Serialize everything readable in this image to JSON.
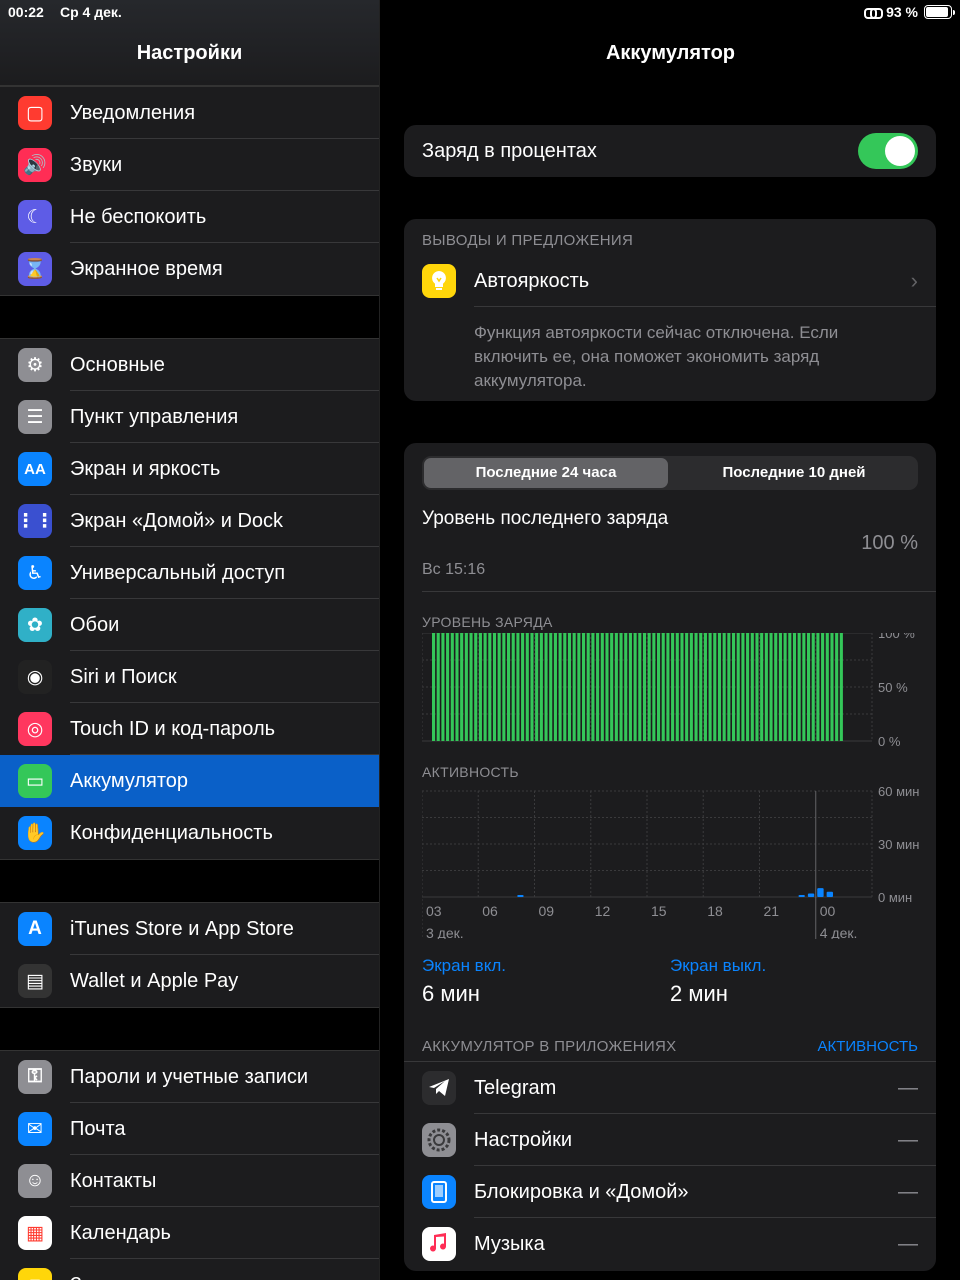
{
  "status": {
    "time": "00:22",
    "date": "Ср 4 дек.",
    "battery": "93 %",
    "battery_level": 0.93
  },
  "sidebar": {
    "title": "Настройки",
    "groups": [
      [
        {
          "label": "Уведомления",
          "icon": "notifications-icon",
          "color": "#ff3b30"
        },
        {
          "label": "Звуки",
          "icon": "speaker-icon",
          "color": "#ff2d55"
        },
        {
          "label": "Не беспокоить",
          "icon": "moon-icon",
          "color": "#5e5ce6"
        },
        {
          "label": "Экранное время",
          "icon": "hourglass-icon",
          "color": "#5e5ce6"
        }
      ],
      [
        {
          "label": "Основные",
          "icon": "gear-icon",
          "color": "#8e8e93"
        },
        {
          "label": "Пункт управления",
          "icon": "switches-icon",
          "color": "#8e8e93"
        },
        {
          "label": "Экран и яркость",
          "icon": "text-size-icon",
          "color": "#0a84ff"
        },
        {
          "label": "Экран «Домой» и Dock",
          "icon": "home-grid-icon",
          "color": "#3a50d0"
        },
        {
          "label": "Универсальный доступ",
          "icon": "accessibility-icon",
          "color": "#0a84ff"
        },
        {
          "label": "Обои",
          "icon": "flower-icon",
          "color": "#30b0c7"
        },
        {
          "label": "Siri и Поиск",
          "icon": "siri-icon",
          "color": "#222"
        },
        {
          "label": "Touch ID и код-пароль",
          "icon": "fingerprint-icon",
          "color": "#ff375f"
        },
        {
          "label": "Аккумулятор",
          "icon": "battery-icon",
          "color": "#34c759",
          "active": true
        },
        {
          "label": "Конфиденциальность",
          "icon": "hand-icon",
          "color": "#0a84ff"
        }
      ],
      [
        {
          "label": "iTunes Store и App Store",
          "icon": "app-store-icon",
          "color": "#0a84ff"
        },
        {
          "label": "Wallet и Apple Pay",
          "icon": "wallet-icon",
          "color": "#333"
        }
      ],
      [
        {
          "label": "Пароли и учетные записи",
          "icon": "key-icon",
          "color": "#8e8e93"
        },
        {
          "label": "Почта",
          "icon": "mail-icon",
          "color": "#0a84ff"
        },
        {
          "label": "Контакты",
          "icon": "contacts-icon",
          "color": "#8e8e93"
        },
        {
          "label": "Календарь",
          "icon": "calendar-icon",
          "color": "#fff"
        },
        {
          "label": "Заметки",
          "icon": "notes-icon",
          "color": "#ffd60a"
        }
      ]
    ]
  },
  "detail": {
    "title": "Аккумулятор",
    "percent_label": "Заряд в процентах",
    "percent_on": true,
    "insights": {
      "caption": "ВЫВОДЫ И ПРЕДЛОЖЕНИЯ",
      "item": "Автояркость",
      "description": "Функция автояркости сейчас отключена. Если включить ее, она поможет экономить заряд аккумулятора."
    },
    "segments": [
      "Последние 24 часа",
      "Последние 10 дней"
    ],
    "last_charge": {
      "title": "Уровень последнего заряда",
      "time": "Вс 15:16",
      "value": "100 %"
    },
    "level_caption": "УРОВЕНЬ ЗАРЯДА",
    "level_ticks": [
      "100 %",
      "50 %",
      "0 %"
    ],
    "activity_caption": "АКТИВНОСТЬ",
    "activity_ticks": [
      "60 мин",
      "30 мин",
      "0 мин"
    ],
    "x_ticks": [
      "03",
      "06",
      "09",
      "12",
      "15",
      "18",
      "21",
      "00"
    ],
    "x_dates": [
      "3 дек.",
      "4 дек."
    ],
    "screen_on": {
      "label": "Экран вкл.",
      "value": "6 мин"
    },
    "screen_off": {
      "label": "Экран выкл.",
      "value": "2 мин"
    },
    "apps_caption": "АККУМУЛЯТОР В ПРИЛОЖЕНИЯХ",
    "apps_action": "АКТИВНОСТЬ",
    "apps": [
      {
        "name": "Telegram",
        "value": "—",
        "icon": "telegram-icon"
      },
      {
        "name": "Настройки",
        "value": "—",
        "icon": "settings-gear-icon"
      },
      {
        "name": "Блокировка и «Домой»",
        "value": "—",
        "icon": "ipad-icon"
      },
      {
        "name": "Музыка",
        "value": "—",
        "icon": "music-icon"
      }
    ]
  },
  "chart_data": [
    {
      "type": "bar",
      "ylabel": "УРОВЕНЬ ЗАРЯДА",
      "ylim": [
        0,
        100
      ],
      "x": [
        "03",
        "06",
        "09",
        "12",
        "15",
        "18",
        "21",
        "00"
      ],
      "values_note_none": true,
      "values": [
        100,
        100,
        100,
        100,
        100,
        100,
        100,
        100,
        100,
        100,
        100,
        100,
        100,
        100,
        100,
        100,
        100,
        100,
        100,
        100,
        100,
        100,
        100,
        100,
        100,
        100,
        100,
        100,
        100,
        100,
        100,
        100,
        100,
        100,
        100,
        100,
        100,
        100,
        100,
        100,
        100,
        100,
        100,
        100,
        100,
        100,
        100,
        100,
        100,
        100,
        100,
        100,
        100,
        100,
        100,
        100,
        100,
        100,
        100,
        100,
        100,
        100,
        100,
        100,
        100,
        100,
        100,
        100,
        100,
        100,
        100,
        100,
        100,
        100,
        100,
        100,
        100,
        100,
        100,
        100,
        100,
        100,
        100,
        100,
        100,
        100,
        100,
        100,
        0,
        0,
        0,
        0,
        0,
        0,
        0,
        0
      ],
      "color": "#34c759"
    },
    {
      "type": "bar",
      "ylabel": "АКТИВНОСТЬ",
      "ylim": [
        0,
        60
      ],
      "x": [
        "03",
        "06",
        "09",
        "12",
        "15",
        "18",
        "21",
        "00"
      ],
      "values": [
        0,
        0,
        0,
        0,
        0,
        0,
        0,
        0,
        0,
        0,
        0,
        0,
        0,
        0,
        0,
        0,
        0,
        0,
        0,
        0,
        0,
        0,
        0,
        0,
        0,
        0,
        0,
        0,
        0,
        0,
        0,
        0,
        0,
        0,
        0,
        0,
        0,
        0,
        0,
        0,
        0,
        0,
        0,
        0,
        0,
        0,
        0,
        0,
        0,
        0,
        0,
        0,
        0,
        0,
        0,
        0,
        0,
        0,
        0,
        0,
        0,
        0,
        0,
        0,
        0,
        0,
        0,
        0,
        0,
        0,
        0,
        0,
        0,
        0,
        0,
        0,
        0,
        0,
        0,
        0,
        0,
        0,
        0,
        0,
        0,
        0,
        0,
        0,
        0,
        0,
        0,
        0,
        0,
        0,
        0,
        0
      ],
      "bars": [
        {
          "slot": 10,
          "value": 0.5
        },
        {
          "slot": 40,
          "value": 1
        },
        {
          "slot": 41,
          "value": 2
        },
        {
          "slot": 42,
          "value": 5
        },
        {
          "slot": 43,
          "value": 3
        }
      ],
      "slots": 48,
      "color": "#0a84ff"
    }
  ]
}
